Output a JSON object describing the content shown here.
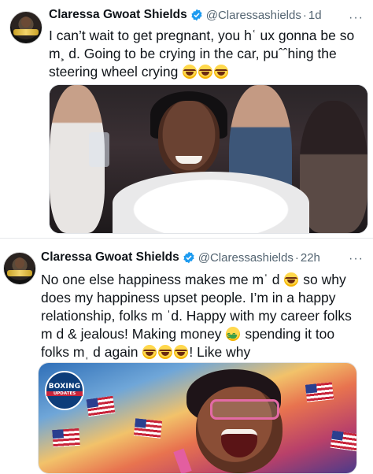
{
  "tweets": [
    {
      "author_name": "Claressa Gwoat Shields",
      "handle": "@Claressashields",
      "separator": "·",
      "time": "1d",
      "more": "···",
      "lines": [
        {
          "text": "I can’t wait to get pregnant, you hʿ ux gonna be so",
          "emojis": []
        },
        {
          "text": "m¸ d. Going to be crying in the car, puˆˆhing the",
          "emojis": []
        },
        {
          "text": "steering wheel crying",
          "emojis": [
            "laughing-emoji",
            "laughing-emoji",
            "laughing-emoji"
          ]
        }
      ],
      "media": "photo",
      "verified_icon": "verified-badge-icon"
    },
    {
      "author_name": "Claressa Gwoat Shields",
      "handle": "@Claressashields",
      "separator": "·",
      "time": "22h",
      "more": "···",
      "lines": [
        {
          "pre": "No one else happiness makes me mˈ d",
          "emoji": "laughing",
          "post": "so why"
        },
        {
          "text": "does my happiness upset people. I’m in a happy"
        },
        {
          "text": "relationship, folks m ˈd. Happy with my career folks"
        },
        {
          "pre": "m  d & jealous! Making money",
          "emoji": "money-mouth",
          "post": "spending it too"
        },
        {
          "pre": "folks mˌ d again",
          "emoji3": "laughing",
          "post": "! Like why"
        }
      ],
      "media_logo": {
        "line1": "BOXING",
        "line2": "UPDATES"
      },
      "verified_icon": "verified-badge-icon"
    }
  ],
  "colors": {
    "verified": "#1d9bf0",
    "text": "#0f1419",
    "secondary": "#536471"
  }
}
